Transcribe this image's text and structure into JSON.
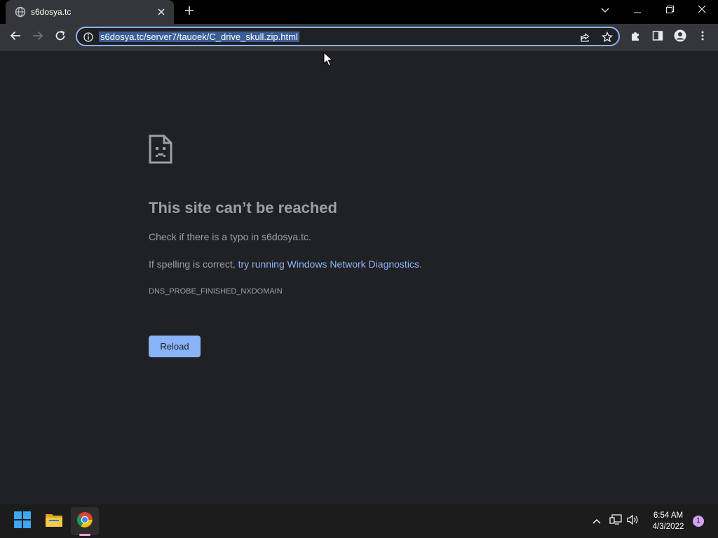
{
  "browser": {
    "tab": {
      "title": "s6dosya.tc",
      "favicon": "globe-icon",
      "close_icon": "close-icon"
    },
    "new_tab_icon": "plus-icon",
    "window_controls": [
      "chevron-down-icon",
      "minimize-icon",
      "restore-icon",
      "close-icon"
    ],
    "toolbar": {
      "nav_icons": [
        "back-arrow-icon",
        "forward-arrow-icon",
        "reload-icon"
      ],
      "omnibox": {
        "url": "s6dosya.tc/server7/tauoek/C_drive_skull.zip.html",
        "info_icon": "info-icon",
        "actions": [
          "share-icon",
          "star-icon"
        ]
      },
      "right_icons": [
        "extensions-icon",
        "side-panel-icon",
        "profile-icon",
        "more-vert-icon"
      ]
    }
  },
  "error_page": {
    "icon": "sad-page-icon",
    "title": "This site can’t be reached",
    "line1": "Check if there is a typo in s6dosya.tc.",
    "line2_prefix": "If spelling is correct, ",
    "line2_link": "try running Windows Network Diagnostics",
    "line2_suffix": ".",
    "error_code": "DNS_PROBE_FINISHED_NXDOMAIN",
    "reload_label": "Reload"
  },
  "taskbar": {
    "apps": [
      "windows-start-icon",
      "file-explorer-icon",
      "chrome-icon"
    ],
    "active_app": "chrome-icon",
    "tray_icons": [
      "chevron-up-icon",
      "network-icon",
      "volume-icon"
    ],
    "time": "6:54 AM",
    "date": "4/3/2022",
    "notification_count": "1"
  },
  "colors": {
    "page_background": "#202124",
    "tab_strip": "#000000",
    "toolbar": "#35363a",
    "accent_blue": "#8ab4f8",
    "url_selection": "#3b5d96",
    "text_muted": "#9aa0a6",
    "taskbar": "#1c1c1c"
  }
}
